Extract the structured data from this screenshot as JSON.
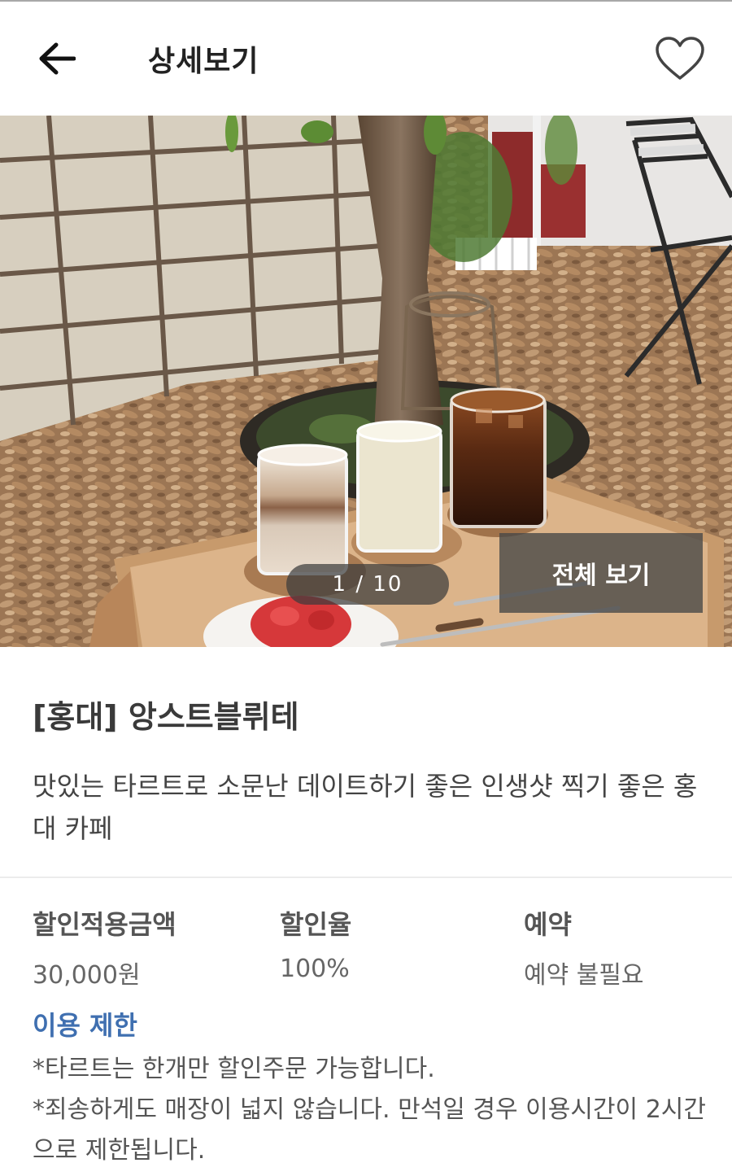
{
  "header": {
    "title": "상세보기",
    "back_icon": "arrow-left-icon",
    "favorite_icon": "heart-outline-icon"
  },
  "gallery": {
    "pager": "1 / 10",
    "view_all_label": "전체 보기",
    "current_index": 1,
    "total": 10
  },
  "store": {
    "name": "[홍대] 앙스트블뤼테",
    "description": "맛있는 타르트로 소문난 데이트하기 좋은 인생샷 찍기 좋은 홍대 카페"
  },
  "details": [
    {
      "label": "할인적용금액",
      "value": "30,000원"
    },
    {
      "label": "할인율",
      "value": "100%"
    },
    {
      "label": "예약",
      "value": "예약 불필요"
    }
  ],
  "restrictions": {
    "title": "이용 제한",
    "items": [
      "*타르트는 한개만 할인주문 가능합니다.",
      "*죄송하게도 매장이 넓지 않습니다. 만석일 경우 이용시간이 2시간으로 제한됩니다."
    ]
  },
  "colors": {
    "accent": "#3f6fb0",
    "text": "#333333",
    "overlay": "#464646"
  }
}
